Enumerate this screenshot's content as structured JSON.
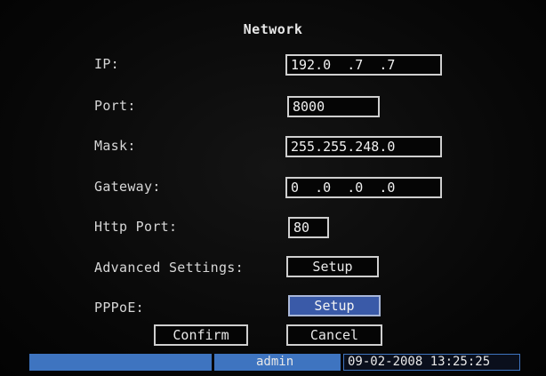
{
  "window": {
    "title": "Network"
  },
  "fields": {
    "ip": {
      "label": "IP:",
      "value": "192.0  .7  .7"
    },
    "port": {
      "label": "Port:",
      "value": "8000"
    },
    "mask": {
      "label": "Mask:",
      "value": "255.255.248.0"
    },
    "gateway": {
      "label": "Gateway:",
      "value": "0  .0  .0  .0"
    },
    "http": {
      "label": "Http Port:",
      "value": "80"
    }
  },
  "advanced": {
    "label": "Advanced Settings:",
    "button": "Setup"
  },
  "pppoe": {
    "label": "PPPoE:",
    "button": "Setup"
  },
  "actions": {
    "confirm": "Confirm",
    "cancel": "Cancel"
  },
  "statusbar": {
    "user": "admin",
    "datetime": "09-02-2008 13:25:25"
  },
  "colors": {
    "background": "#070707",
    "text": "#d6d6d6",
    "field_border": "#cfcfcf",
    "selected_button": "#3a5aa8",
    "status_blue": "#3e74c0"
  }
}
